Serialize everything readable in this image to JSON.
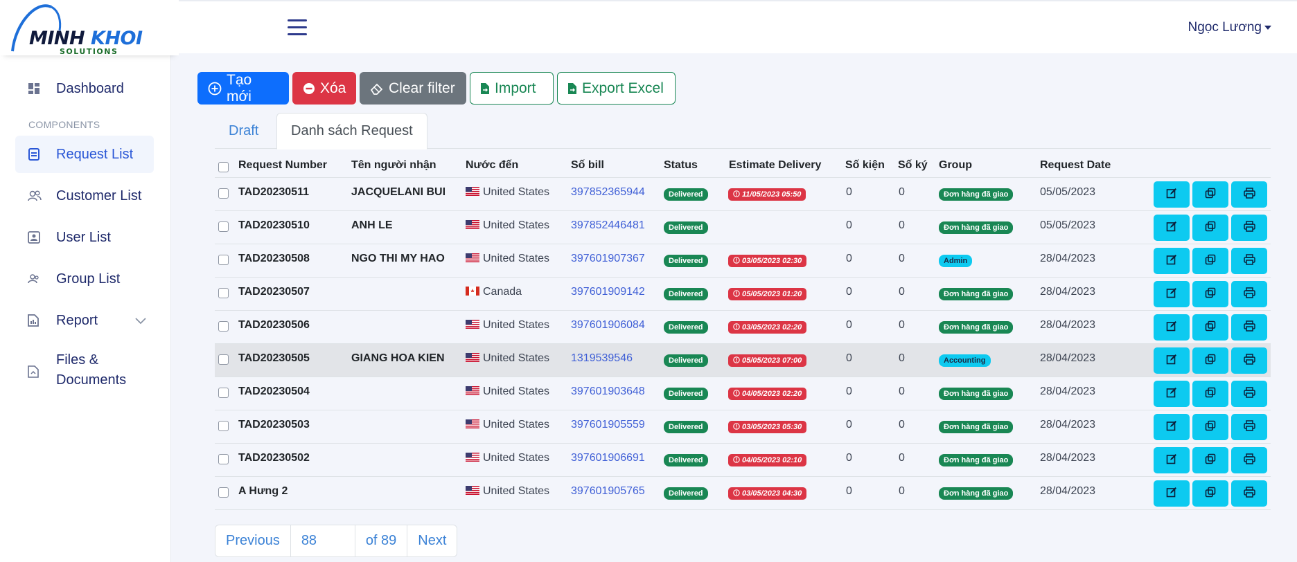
{
  "brand": {
    "name_part1": "MINH",
    "name_part2": "KHOI",
    "sub": "SOLUTIONS"
  },
  "sidebar": {
    "section_label": "COMPONENTS",
    "items": [
      {
        "label": "Dashboard",
        "icon": "dashboard-icon"
      },
      {
        "label": "Request List",
        "icon": "list-icon",
        "active": true
      },
      {
        "label": "Customer List",
        "icon": "users-icon"
      },
      {
        "label": "User List",
        "icon": "user-card-icon"
      },
      {
        "label": "Group List",
        "icon": "group-icon"
      },
      {
        "label": "Report",
        "icon": "report-icon"
      },
      {
        "label": "Files & Documents",
        "icon": "file-icon"
      }
    ]
  },
  "topbar": {
    "user_name": "Ngọc Lương"
  },
  "toolbar": {
    "create": "Tạo mới",
    "delete": "Xóa",
    "clear_filter": "Clear filter",
    "import": "Import",
    "export": "Export Excel"
  },
  "tabs": {
    "draft": "Draft",
    "requests": "Danh sách Request"
  },
  "table": {
    "headers": {
      "request_number": "Request Number",
      "recipient": "Tên người nhận",
      "destination": "Nước đến",
      "bill": "Số bill",
      "status": "Status",
      "estimate": "Estimate Delivery",
      "packages": "Số kiện",
      "signed": "Số ký",
      "group": "Group",
      "date": "Request Date"
    },
    "rows": [
      {
        "req": "TAD20230511",
        "name": "JACQUELANI BUI",
        "country": "United States",
        "bill": "397852365944",
        "status": "Delivered",
        "eta": "11/05/2023 05:50",
        "pkg": "0",
        "kg": "0",
        "group": "Đơn hàng đã giao",
        "date": "05/05/2023"
      },
      {
        "req": "TAD20230510",
        "name": "ANH LE",
        "country": "United States",
        "bill": "397852446481",
        "status": "Delivered",
        "eta": "",
        "pkg": "0",
        "kg": "0",
        "group": "Đơn hàng đã giao",
        "date": "05/05/2023"
      },
      {
        "req": "TAD20230508",
        "name": "NGO THI MY HAO",
        "country": "United States",
        "bill": "397601907367",
        "status": "Delivered",
        "eta": "03/05/2023 02:30",
        "pkg": "0",
        "kg": "0",
        "group": "Admin",
        "date": "28/04/2023"
      },
      {
        "req": "TAD20230507",
        "name": "",
        "country": "Canada",
        "bill": "397601909142",
        "status": "Delivered",
        "eta": "05/05/2023 01:20",
        "pkg": "0",
        "kg": "0",
        "group": "Đơn hàng đã giao",
        "date": "28/04/2023"
      },
      {
        "req": "TAD20230506",
        "name": "",
        "country": "United States",
        "bill": "397601906084",
        "status": "Delivered",
        "eta": "03/05/2023 02:20",
        "pkg": "0",
        "kg": "0",
        "group": "Đơn hàng đã giao",
        "date": "28/04/2023"
      },
      {
        "req": "TAD20230505",
        "name": "GIANG HOA KIEN",
        "country": "United States",
        "bill": "1319539546",
        "status": "Delivered",
        "eta": "05/05/2023 07:00",
        "pkg": "0",
        "kg": "0",
        "group": "Accounting",
        "date": "28/04/2023"
      },
      {
        "req": "TAD20230504",
        "name": "",
        "country": "United States",
        "bill": "397601903648",
        "status": "Delivered",
        "eta": "04/05/2023 02:20",
        "pkg": "0",
        "kg": "0",
        "group": "Đơn hàng đã giao",
        "date": "28/04/2023"
      },
      {
        "req": "TAD20230503",
        "name": "",
        "country": "United States",
        "bill": "397601905559",
        "status": "Delivered",
        "eta": "03/05/2023 05:30",
        "pkg": "0",
        "kg": "0",
        "group": "Đơn hàng đã giao",
        "date": "28/04/2023"
      },
      {
        "req": "TAD20230502",
        "name": "",
        "country": "United States",
        "bill": "397601906691",
        "status": "Delivered",
        "eta": "04/05/2023 02:10",
        "pkg": "0",
        "kg": "0",
        "group": "Đơn hàng đã giao",
        "date": "28/04/2023"
      },
      {
        "req": "A Hưng 2",
        "name": "",
        "country": "United States",
        "bill": "397601905765",
        "status": "Delivered",
        "eta": "03/05/2023 04:30",
        "pkg": "0",
        "kg": "0",
        "group": "Đơn hàng đã giao",
        "date": "28/04/2023"
      }
    ]
  },
  "pagination": {
    "previous": "Previous",
    "page": "88",
    "of": "of 89",
    "next": "Next"
  },
  "colors": {
    "primary": "#0d6efd",
    "danger": "#dc3545",
    "success": "#198754",
    "info": "#0dcaf0",
    "secondary": "#6c757d"
  }
}
